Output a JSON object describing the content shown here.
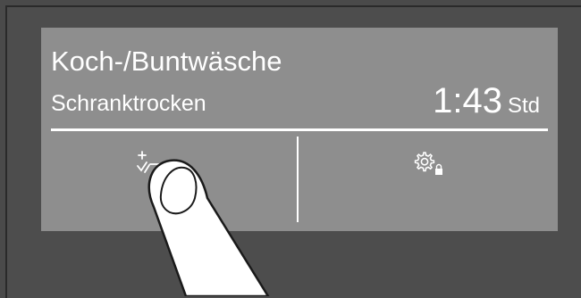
{
  "display": {
    "program_title": "Koch-/Buntwäsche",
    "sub_program": "Schranktrocken",
    "remaining_time": "1:43",
    "time_unit": "Std"
  },
  "buttons": {
    "options_icon": "options-checklist-icon",
    "settings_icon": "settings-gear-lock-icon"
  },
  "colors": {
    "screen_bg": "#8e8e8e",
    "frame_bg": "#4d4d4d",
    "text": "#ffffff"
  }
}
